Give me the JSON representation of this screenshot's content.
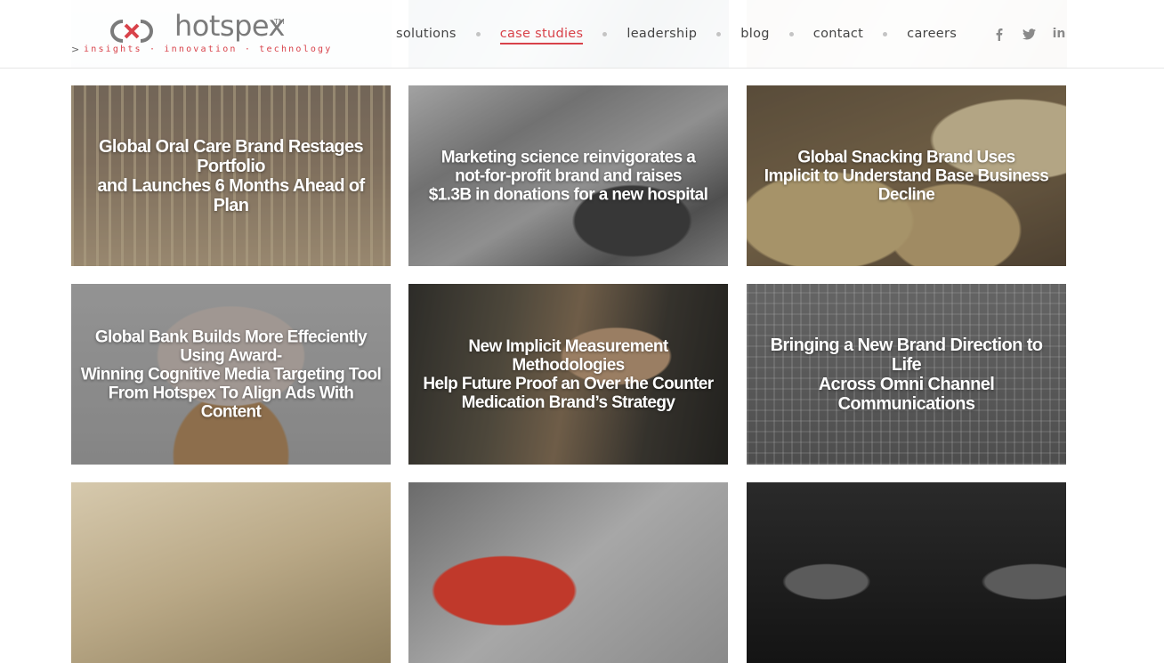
{
  "brand": {
    "name": "hotspex",
    "trademark": "TM",
    "tagline_arrow": ">",
    "tagline": "insights · innovation · technology",
    "accent_color": "#d8424a"
  },
  "nav": {
    "items": [
      {
        "label": "solutions",
        "active": false
      },
      {
        "label": "case studies",
        "active": true
      },
      {
        "label": "leadership",
        "active": false
      },
      {
        "label": "blog",
        "active": false
      },
      {
        "label": "contact",
        "active": false
      },
      {
        "label": "careers",
        "active": false
      }
    ],
    "social": [
      {
        "icon": "facebook-icon"
      },
      {
        "icon": "twitter-icon"
      },
      {
        "icon": "linkedin-icon",
        "text": "in"
      }
    ]
  },
  "case_studies": [
    {
      "title": "Global Oral Care Brand Restages Portfolio\nand Launches 6 Months Ahead of Plan"
    },
    {
      "title": "Marketing science reinvigorates a\nnot-for-profit brand and raises\n$1.3B in donations for a new hospital"
    },
    {
      "title": "Global Snacking Brand Uses\nImplicit to Understand Base Business Decline"
    },
    {
      "title": "Global Bank Builds More Effeciently Using Award-\nWinning Cognitive Media Targeting Tool\nFrom Hotspex To Align Ads With Content"
    },
    {
      "title": "New Implicit Measurement Methodologies\nHelp Future Proof an Over the Counter\nMedication Brand’s Strategy"
    },
    {
      "title": "Bringing a New Brand Direction to Life\nAcross Omni Channel Communications"
    },
    {
      "title": ""
    },
    {
      "title": ""
    },
    {
      "title": ""
    }
  ]
}
